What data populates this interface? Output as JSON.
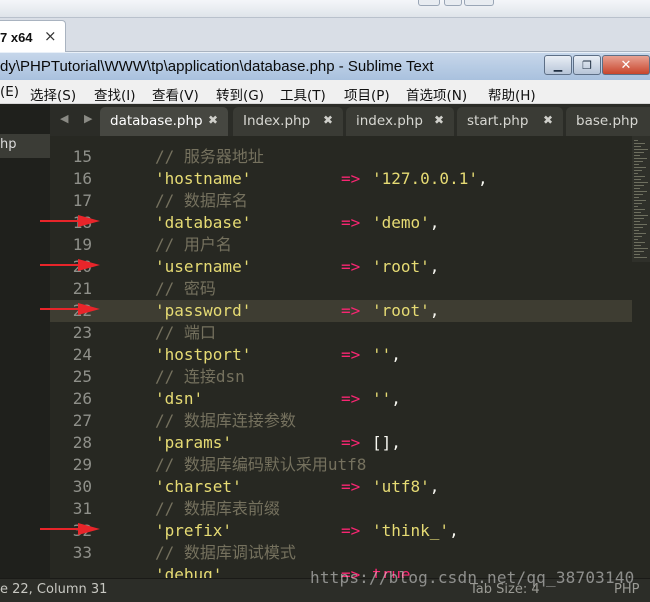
{
  "browser": {
    "tab_label": "7 x64",
    "tab_close": "×"
  },
  "window": {
    "title": "dy\\PHPTutorial\\WWW\\tp\\application\\database.php - Sublime Text",
    "minimize": "▁",
    "maximize": "❐",
    "close": "✕"
  },
  "menu": [
    "(E)",
    "选择(S)",
    "查找(I)",
    "查看(V)",
    "转到(G)",
    "工具(T)",
    "项目(P)",
    "首选项(N)",
    "帮助(H)"
  ],
  "sidebar": {
    "item": "hp"
  },
  "tabs": [
    {
      "label": "database.php",
      "close": "✖",
      "active": true
    },
    {
      "label": "Index.php",
      "close": "✖",
      "active": false
    },
    {
      "label": "index.php",
      "close": "✖",
      "active": false
    },
    {
      "label": "start.php",
      "close": "✖",
      "active": false
    },
    {
      "label": "base.php",
      "close": "",
      "active": false
    }
  ],
  "nav_arrows": "◀ ▶",
  "code": [
    {
      "n": "15",
      "type": "comment",
      "text": "// 服务器地址"
    },
    {
      "n": "16",
      "type": "pair",
      "key": "'hostname'",
      "op": "=>",
      "value": "'127.0.0.1'",
      "end": ","
    },
    {
      "n": "17",
      "type": "comment",
      "text": "// 数据库名"
    },
    {
      "n": "18",
      "type": "pair",
      "key": "'database'",
      "op": "=>",
      "value": "'demo'",
      "end": ","
    },
    {
      "n": "19",
      "type": "comment",
      "text": "// 用户名"
    },
    {
      "n": "20",
      "type": "pair",
      "key": "'username'",
      "op": "=>",
      "value": "'root'",
      "end": ","
    },
    {
      "n": "21",
      "type": "comment",
      "text": "// 密码"
    },
    {
      "n": "22",
      "type": "pair",
      "key": "'password'",
      "op": "=>",
      "value": "'root'",
      "end": ","
    },
    {
      "n": "23",
      "type": "comment",
      "text": "// 端口"
    },
    {
      "n": "24",
      "type": "pair",
      "key": "'hostport'",
      "op": "=>",
      "value": "''",
      "end": ","
    },
    {
      "n": "25",
      "type": "comment",
      "text": "// 连接dsn"
    },
    {
      "n": "26",
      "type": "pair",
      "key": "'dsn'",
      "op": "=>",
      "value": "''",
      "end": ","
    },
    {
      "n": "27",
      "type": "comment",
      "text": "// 数据库连接参数"
    },
    {
      "n": "28",
      "type": "pair",
      "key": "'params'",
      "op": "=>",
      "value": "[]",
      "end": ","
    },
    {
      "n": "29",
      "type": "comment",
      "text": "// 数据库编码默认采用utf8"
    },
    {
      "n": "30",
      "type": "pair",
      "key": "'charset'",
      "op": "=>",
      "value": "'utf8'",
      "end": ","
    },
    {
      "n": "31",
      "type": "comment",
      "text": "// 数据库表前缀"
    },
    {
      "n": "32",
      "type": "pair",
      "key": "'prefix'",
      "op": "=>",
      "value": "'think_'",
      "end": ","
    },
    {
      "n": "33",
      "type": "comment",
      "text": "// 数据库调试模式"
    },
    {
      "n": "",
      "type": "pair",
      "key": "'debug'",
      "op": "=>",
      "value": "true",
      "end": ""
    }
  ],
  "status": {
    "position": "e 22, Column 31",
    "tab_size": "Tab Size: 4",
    "syntax": "PHP"
  },
  "watermark": "https://blog.csdn.net/qq_38703140",
  "colors": {
    "background": "#272822",
    "comment": "#75715e",
    "string": "#e6db74",
    "operator": "#f92672",
    "arrow": "#e8252a"
  }
}
